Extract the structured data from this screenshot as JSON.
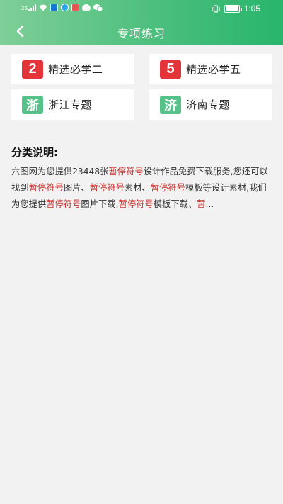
{
  "status_bar": {
    "signal_label": "26",
    "time": "1:05"
  },
  "header": {
    "back_icon": "chevron-left-icon",
    "title": "专项练习"
  },
  "categories": [
    {
      "badge": "2",
      "badge_color": "#e3343a",
      "label": "精选必学二"
    },
    {
      "badge": "5",
      "badge_color": "#e3343a",
      "label": "精选必学五"
    },
    {
      "badge": "浙",
      "badge_color": "#56c189",
      "label": "浙江专题"
    },
    {
      "badge": "济",
      "badge_color": "#56c189",
      "label": "济南专题"
    }
  ],
  "description": {
    "title": "分类说明:",
    "segments": [
      {
        "text": "六图网为您提供23448张",
        "highlight": false
      },
      {
        "text": "暂停符号",
        "highlight": true
      },
      {
        "text": "设计作品免费下载服务,您还可以找到",
        "highlight": false
      },
      {
        "text": "暂停符号",
        "highlight": true
      },
      {
        "text": "图片、",
        "highlight": false
      },
      {
        "text": "暂停符号",
        "highlight": true
      },
      {
        "text": "素材、",
        "highlight": false
      },
      {
        "text": "暂停符号",
        "highlight": true
      },
      {
        "text": "模板等设计素材,我们为您提供",
        "highlight": false
      },
      {
        "text": "暂停符号",
        "highlight": true
      },
      {
        "text": "图片下载,",
        "highlight": false
      },
      {
        "text": "暂停符号",
        "highlight": true
      },
      {
        "text": "模板下载、",
        "highlight": false
      },
      {
        "text": "暂",
        "highlight": true
      },
      {
        "text": "...",
        "highlight": false
      }
    ]
  },
  "colors": {
    "header_start": "#7fcf97",
    "header_end": "#27b56c",
    "highlight": "#c9302c",
    "background": "#f2f2f2"
  }
}
